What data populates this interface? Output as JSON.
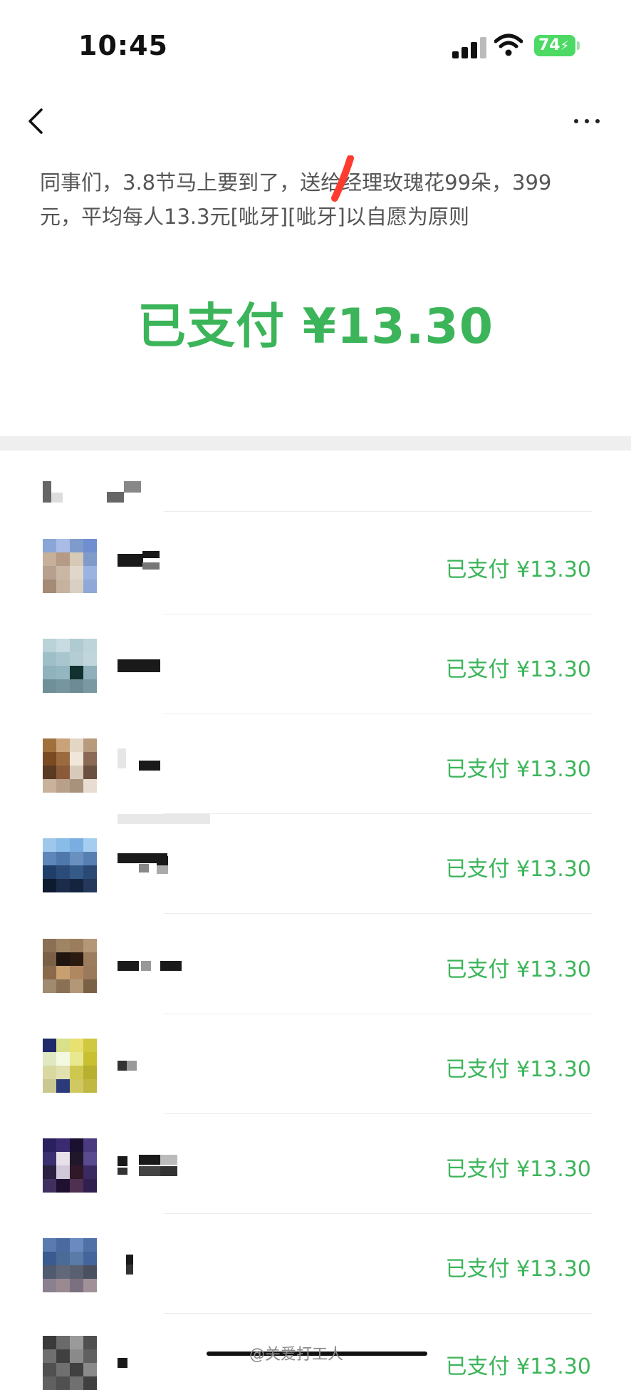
{
  "status_bar": {
    "time": "10:45",
    "battery": "74"
  },
  "message": "同事们，3.8节马上要到了，送给经理玫瑰花99朵，399元，平均每人13.3元[呲牙][呲牙]以自愿为原则",
  "paid_summary": "已支付 ¥13.30",
  "rows": [
    {
      "status": "已支付 ¥13.30"
    },
    {
      "status": "已支付 ¥13.30"
    },
    {
      "status": "已支付 ¥13.30"
    },
    {
      "status": "已支付 ¥13.30"
    },
    {
      "status": "已支付 ¥13.30"
    },
    {
      "status": "已支付 ¥13.30"
    },
    {
      "status": "已支付 ¥13.30"
    },
    {
      "status": "已支付 ¥13.30"
    },
    {
      "status": "已支付 ¥13.30"
    }
  ],
  "watermark": "@关爱打工人",
  "colors": {
    "accent": "#3cb55a",
    "text_secondary": "#555555"
  },
  "icons": {
    "back": "chevron-left-icon",
    "more": "more-dots-icon",
    "wifi": "wifi-icon",
    "signal": "signal-icon",
    "battery": "battery-icon"
  }
}
